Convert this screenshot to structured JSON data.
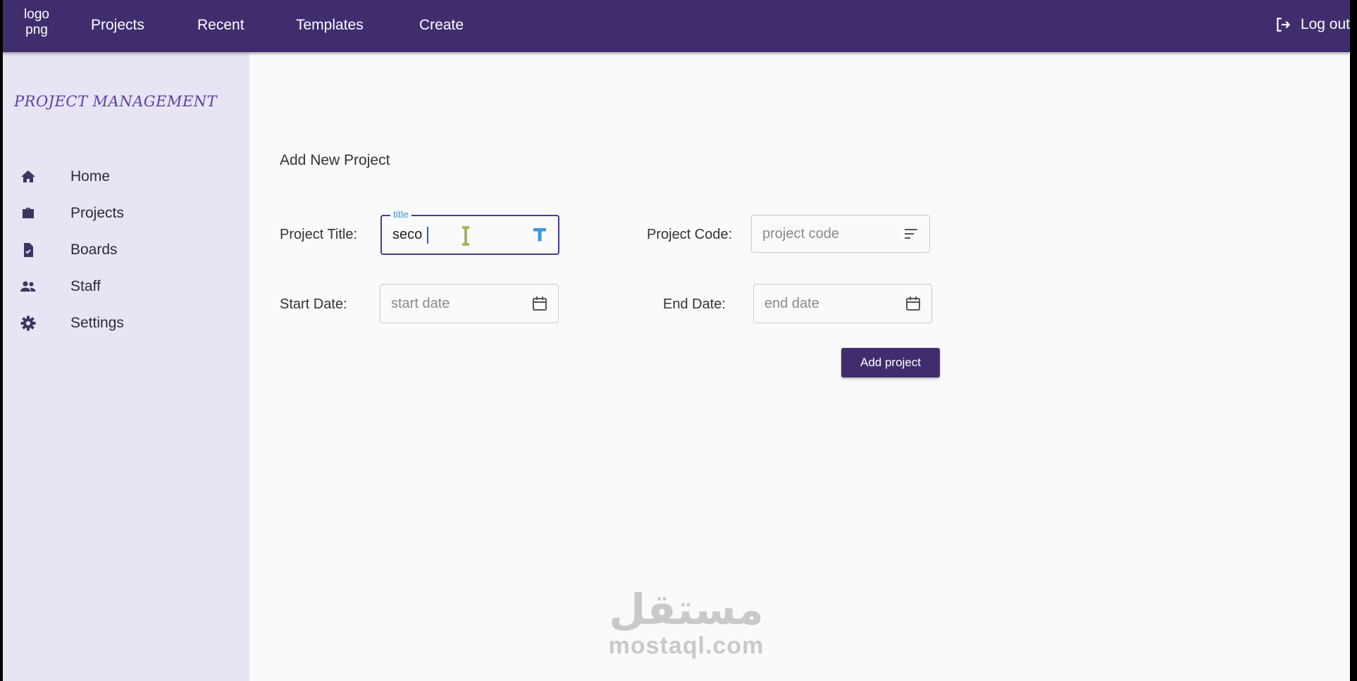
{
  "topbar": {
    "logo_line1": "logo",
    "logo_line2": "png",
    "nav": [
      "Projects",
      "Recent",
      "Templates",
      "Create"
    ],
    "logout_label": "Log out",
    "bg_color": "#402d6e"
  },
  "sidebar": {
    "brand": "PROJECT MANAGEMENT",
    "items": [
      {
        "label": "Home",
        "icon": "home-icon"
      },
      {
        "label": "Projects",
        "icon": "briefcase-icon"
      },
      {
        "label": "Boards",
        "icon": "document-check-icon"
      },
      {
        "label": "Staff",
        "icon": "people-icon"
      },
      {
        "label": "Settings",
        "icon": "gear-icon"
      }
    ]
  },
  "form": {
    "title": "Add New Project",
    "project_title": {
      "label": "Project Title:",
      "float_label": "title",
      "value": "seco",
      "icon": "text-format-icon"
    },
    "project_code": {
      "label": "Project Code:",
      "placeholder": "project code",
      "value": "",
      "icon": "sort-lines-icon"
    },
    "start_date": {
      "label": "Start Date:",
      "placeholder": "start date",
      "value": "",
      "icon": "calendar-icon"
    },
    "end_date": {
      "label": "End Date:",
      "placeholder": "end date",
      "value": "",
      "icon": "calendar-icon"
    },
    "submit_label": "Add project"
  },
  "watermark": {
    "arabic": "مستقل",
    "latin": "mostaql.com"
  }
}
